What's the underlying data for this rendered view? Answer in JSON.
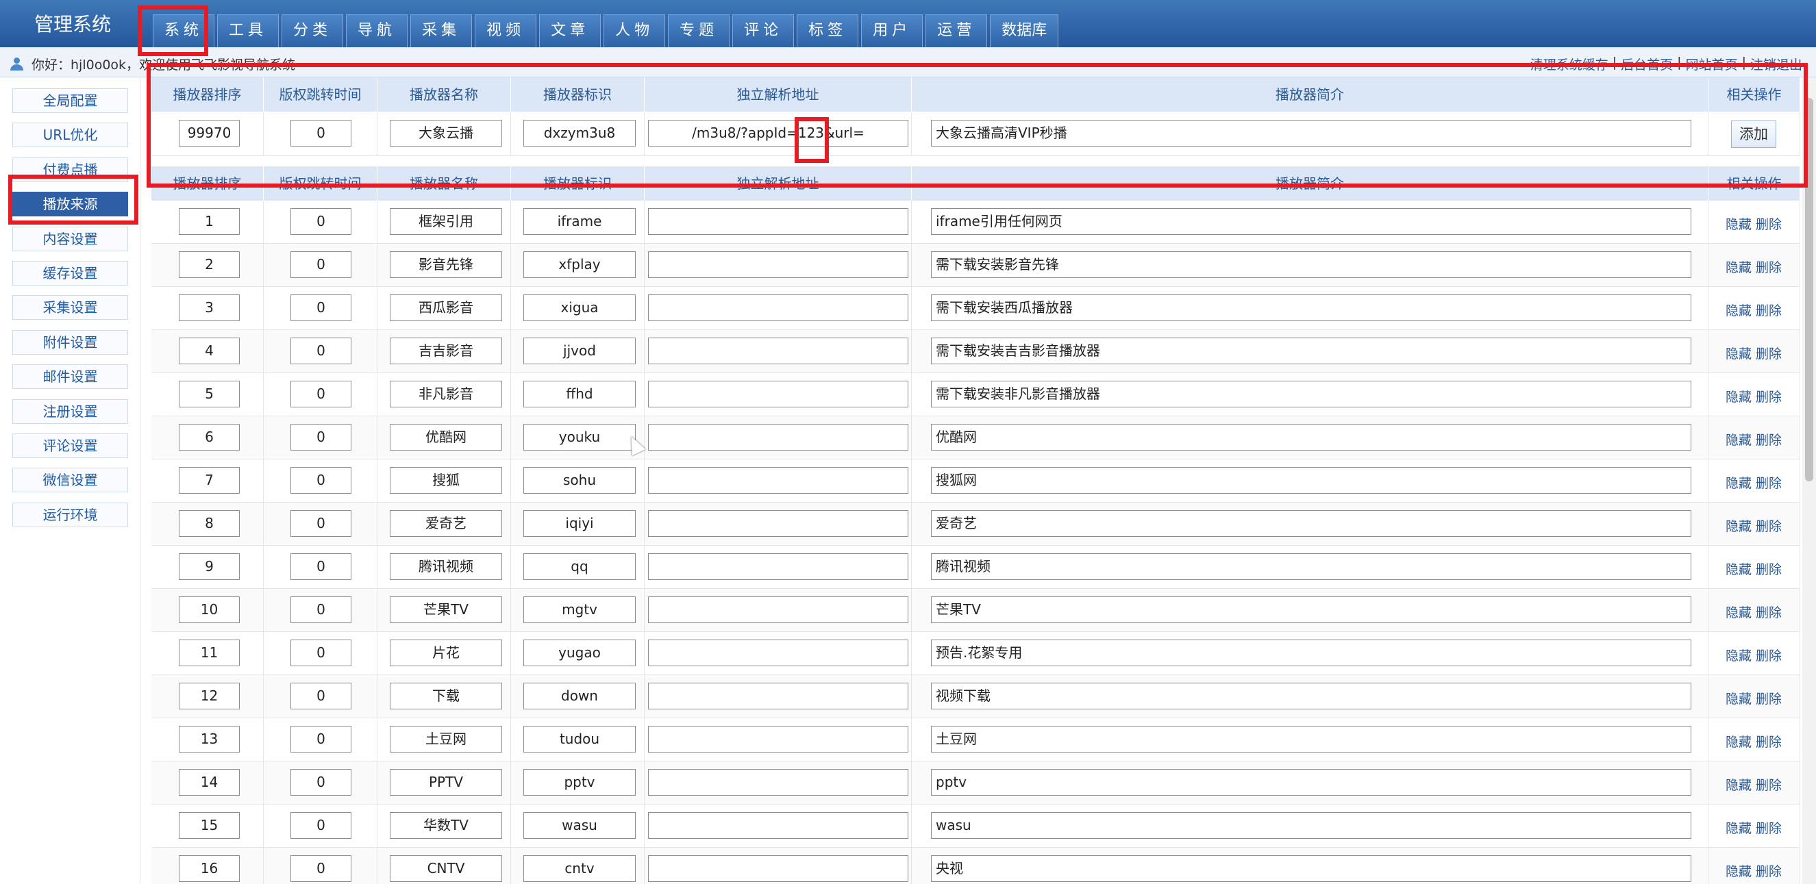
{
  "app_title": "管理系统",
  "nav_tabs": [
    "系统",
    "工具",
    "分类",
    "导航",
    "采集",
    "视频",
    "文章",
    "人物",
    "专题",
    "评论",
    "标签",
    "用户",
    "运营",
    "数据库"
  ],
  "welcome_text": "你好：hjl0o0ok，欢迎使用飞飞影视导航系统",
  "top_links": [
    "清理系统缓存",
    "后台首页",
    "网站首页",
    "注销退出"
  ],
  "sidebar": [
    "全局配置",
    "URL优化",
    "付费点播",
    "播放来源",
    "内容设置",
    "缓存设置",
    "采集设置",
    "附件设置",
    "邮件设置",
    "注册设置",
    "评论设置",
    "微信设置",
    "运行环境"
  ],
  "active_sidebar": "播放来源",
  "columns": [
    "播放器排序",
    "版权跳转时间",
    "播放器名称",
    "播放器标识",
    "独立解析地址",
    "播放器简介",
    "相关操作"
  ],
  "new_player": {
    "sort": "99970",
    "jump_time": "0",
    "name": "大象云播",
    "code": "dxzym3u8",
    "parse_url": "/m3u8/?appId=123&url=",
    "intro": "大象云播高清VIP秒播",
    "action": "添加"
  },
  "row_actions": [
    "隐藏",
    "删除"
  ],
  "players": [
    {
      "sort": "1",
      "jump_time": "0",
      "name": "框架引用",
      "code": "iframe",
      "parse_url": "",
      "intro": "iframe引用任何网页"
    },
    {
      "sort": "2",
      "jump_time": "0",
      "name": "影音先锋",
      "code": "xfplay",
      "parse_url": "",
      "intro": "需下载安装影音先锋"
    },
    {
      "sort": "3",
      "jump_time": "0",
      "name": "西瓜影音",
      "code": "xigua",
      "parse_url": "",
      "intro": "需下载安装西瓜播放器"
    },
    {
      "sort": "4",
      "jump_time": "0",
      "name": "吉吉影音",
      "code": "jjvod",
      "parse_url": "",
      "intro": "需下载安装吉吉影音播放器"
    },
    {
      "sort": "5",
      "jump_time": "0",
      "name": "非凡影音",
      "code": "ffhd",
      "parse_url": "",
      "intro": "需下载安装非凡影音播放器"
    },
    {
      "sort": "6",
      "jump_time": "0",
      "name": "优酷网",
      "code": "youku",
      "parse_url": "",
      "intro": "优酷网"
    },
    {
      "sort": "7",
      "jump_time": "0",
      "name": "搜狐",
      "code": "sohu",
      "parse_url": "",
      "intro": "搜狐网"
    },
    {
      "sort": "8",
      "jump_time": "0",
      "name": "爱奇艺",
      "code": "iqiyi",
      "parse_url": "",
      "intro": "爱奇艺"
    },
    {
      "sort": "9",
      "jump_time": "0",
      "name": "腾讯视频",
      "code": "qq",
      "parse_url": "",
      "intro": "腾讯视频"
    },
    {
      "sort": "10",
      "jump_time": "0",
      "name": "芒果TV",
      "code": "mgtv",
      "parse_url": "",
      "intro": "芒果TV"
    },
    {
      "sort": "11",
      "jump_time": "0",
      "name": "片花",
      "code": "yugao",
      "parse_url": "",
      "intro": "预告.花絮专用"
    },
    {
      "sort": "12",
      "jump_time": "0",
      "name": "下载",
      "code": "down",
      "parse_url": "",
      "intro": "视频下载"
    },
    {
      "sort": "13",
      "jump_time": "0",
      "name": "土豆网",
      "code": "tudou",
      "parse_url": "",
      "intro": "土豆网"
    },
    {
      "sort": "14",
      "jump_time": "0",
      "name": "PPTV",
      "code": "pptv",
      "parse_url": "",
      "intro": "pptv"
    },
    {
      "sort": "15",
      "jump_time": "0",
      "name": "华数TV",
      "code": "wasu",
      "parse_url": "",
      "intro": "wasu"
    },
    {
      "sort": "16",
      "jump_time": "0",
      "name": "CNTV",
      "code": "cntv",
      "parse_url": "",
      "intro": "央视"
    }
  ],
  "colors": {
    "topbar": "#2d63a6",
    "highlight": "#e61c24",
    "link": "#2a5a96",
    "header_bg": "#dbe7f6",
    "active_side": "#2e5ea3"
  }
}
